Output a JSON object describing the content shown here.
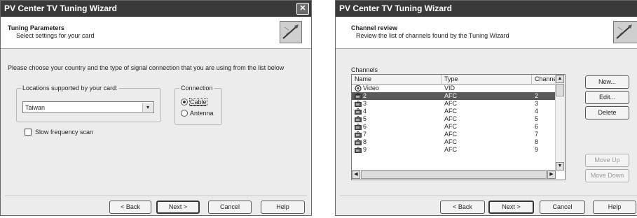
{
  "wizard1": {
    "title": "PV Center TV Tuning Wizard",
    "close_glyph": "✕",
    "header_title": "Tuning Parameters",
    "header_subtitle": "Select settings for your card",
    "instructions": "Please choose your country and the type of signal connection that you are using from the list below",
    "locations_label": "Locations supported by your card:",
    "location_value": "Taiwan",
    "connection_label": "Connection",
    "radio_cable": "Cable",
    "radio_antenna": "Antenna",
    "selected_connection": "Cable",
    "slow_scan_label": "Slow frequency scan",
    "slow_scan_checked": false,
    "buttons": {
      "back": "< Back",
      "next": "Next >",
      "cancel": "Cancel",
      "help": "Help"
    }
  },
  "wizard2": {
    "title": "PV Center TV Tuning Wizard",
    "header_title": "Channel review",
    "header_subtitle": "Review the list of channels found by the Tuning Wizard",
    "channels_label": "Channels",
    "columns": [
      "Name",
      "Type",
      "Channel"
    ],
    "rows": [
      {
        "name": "Video",
        "type": "VID",
        "channel": "",
        "icon": "video-source-icon"
      },
      {
        "name": "2",
        "type": "AFC",
        "channel": "2",
        "icon": "tv-icon",
        "selected": true
      },
      {
        "name": "3",
        "type": "AFC",
        "channel": "3",
        "icon": "tv-icon"
      },
      {
        "name": "4",
        "type": "AFC",
        "channel": "4",
        "icon": "tv-icon"
      },
      {
        "name": "5",
        "type": "AFC",
        "channel": "5",
        "icon": "tv-icon"
      },
      {
        "name": "6",
        "type": "AFC",
        "channel": "6",
        "icon": "tv-icon"
      },
      {
        "name": "7",
        "type": "AFC",
        "channel": "7",
        "icon": "tv-icon"
      },
      {
        "name": "8",
        "type": "AFC",
        "channel": "8",
        "icon": "tv-icon"
      },
      {
        "name": "9",
        "type": "AFC",
        "channel": "9",
        "icon": "tv-icon"
      }
    ],
    "side_buttons": {
      "new": "New...",
      "edit": "Edit...",
      "delete": "Delete",
      "move_up": "Move Up",
      "move_down": "Move Down"
    },
    "buttons": {
      "back": "< Back",
      "next": "Next >",
      "cancel": "Cancel",
      "help": "Help"
    }
  },
  "colors": {
    "titlebar": "#3a3a3a",
    "selection": "#5a5a5a",
    "dialog_bg": "#ececec"
  }
}
